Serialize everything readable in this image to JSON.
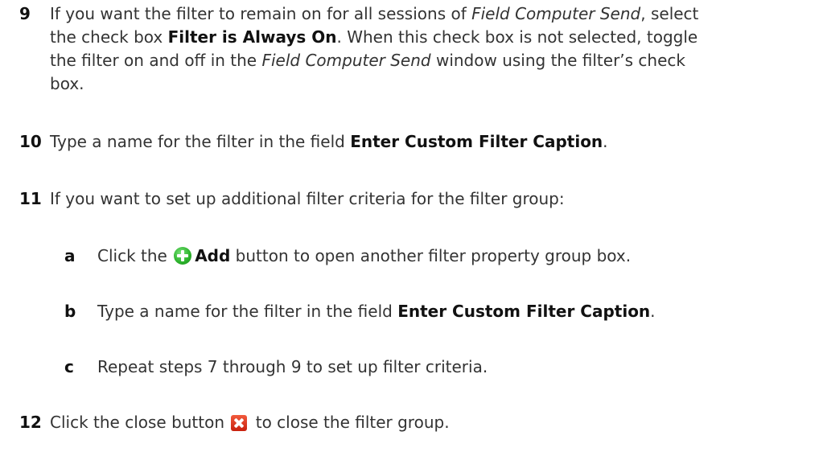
{
  "steps": {
    "s9": {
      "number": "9",
      "line1": {
        "a": "If you want the filter to remain on for all sessions of ",
        "b": "Field Computer Send",
        "c": ", select"
      },
      "line2": {
        "a": "the check box ",
        "b": "Filter is Always On",
        "c": ". When this check box is not selected, toggle"
      },
      "line3": {
        "a": "the filter on and off in the ",
        "b": "Field Computer Send",
        "c": " window using the filter’s check"
      },
      "line4": "box."
    },
    "s10": {
      "number": "10",
      "a": "Type a name for the filter in the field ",
      "b": "Enter Custom Filter Caption",
      "c": "."
    },
    "s11": {
      "number": "11",
      "text": "If you want to set up additional filter criteria for the filter group:",
      "sub_a": {
        "letter": "a",
        "a": "Click the ",
        "b": "Add",
        "c": " button to open another filter property group box."
      },
      "sub_b": {
        "letter": "b",
        "a": "Type a name for the filter in the field ",
        "b": "Enter Custom Filter Caption",
        "c": "."
      },
      "sub_c": {
        "letter": "c",
        "text": "Repeat steps 7 through 9 to set up filter criteria."
      }
    },
    "s12": {
      "number": "12",
      "a": "Click the close button ",
      "b": " to close the filter group."
    }
  },
  "icons": {
    "add": "green-plus-circle-icon",
    "close": "red-x-close-icon"
  }
}
